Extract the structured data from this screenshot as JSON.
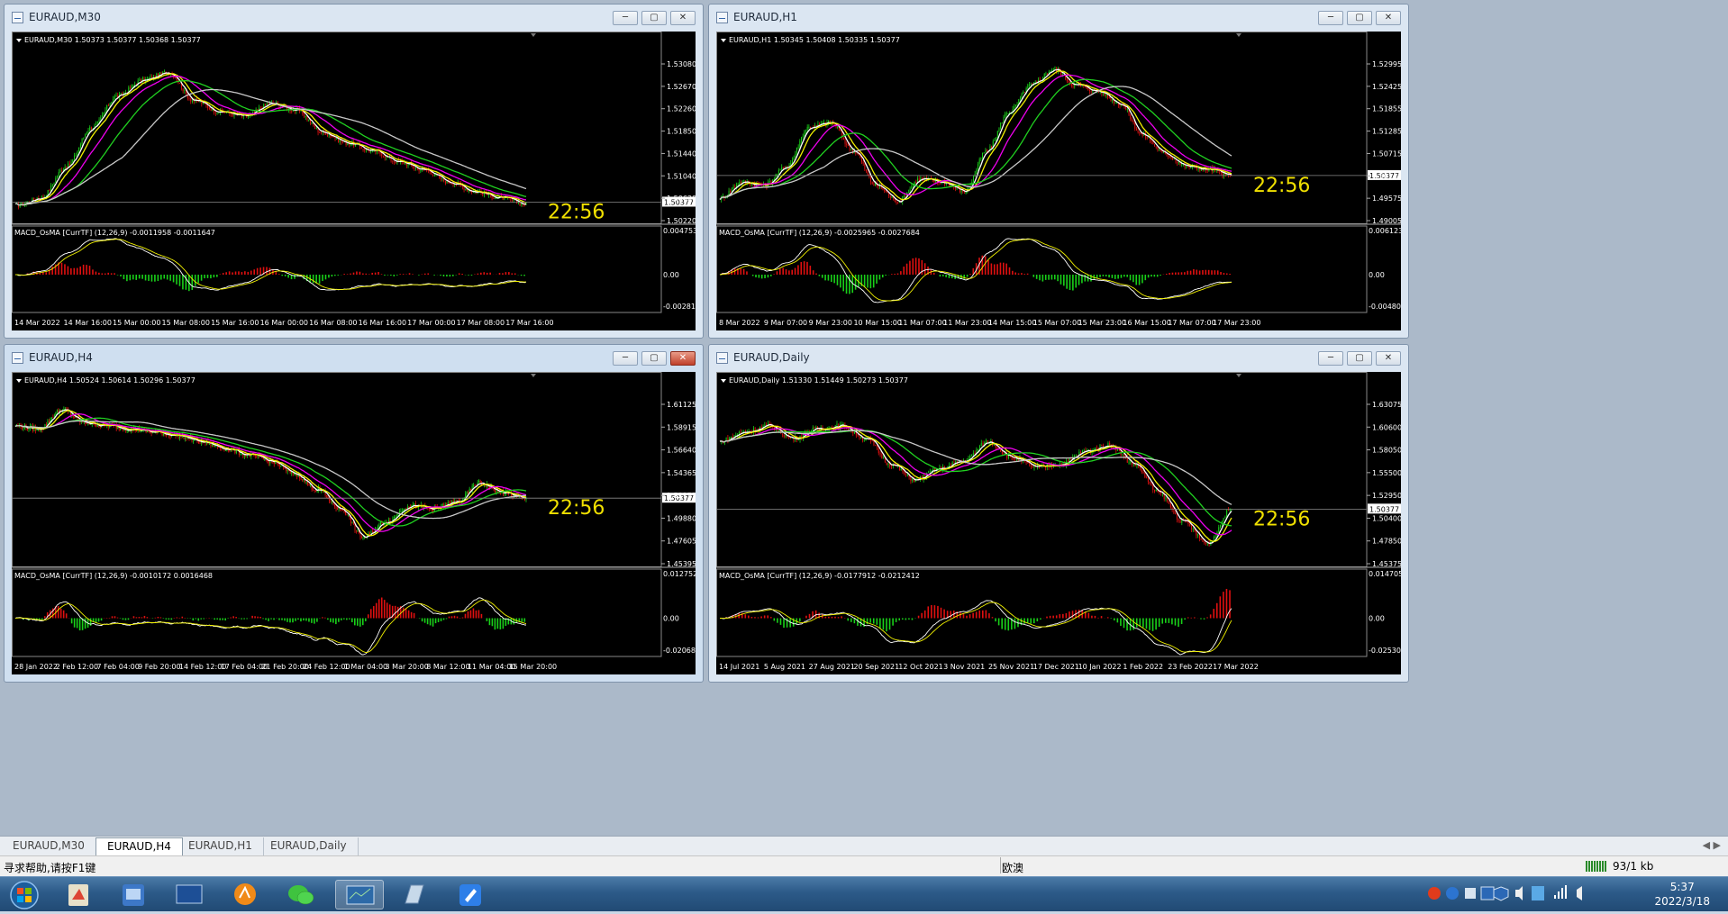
{
  "windows": [
    {
      "id": "m30",
      "title": "EURAUD,M30",
      "info": "EURAUD,M30  1.50373 1.50377 1.50368 1.50377",
      "prices": [
        "1.53080",
        "1.52670",
        "1.52260",
        "1.51850",
        "1.51440",
        "1.51040",
        "1.50630",
        "1.50220"
      ],
      "bid": "1.50377",
      "clock": "22:56",
      "macd_info": "MACD_OsMA [CurrTF] (12,26,9) -0.0011958 -0.0011647",
      "macd_scale": [
        "0.0047535",
        "0.00",
        "-0.002811"
      ],
      "dates": [
        "14 Mar 2022",
        "14 Mar 16:00",
        "15 Mar 00:00",
        "15 Mar 08:00",
        "15 Mar 16:00",
        "16 Mar 00:00",
        "16 Mar 08:00",
        "16 Mar 16:00",
        "17 Mar 00:00",
        "17 Mar 08:00",
        "17 Mar 16:00"
      ]
    },
    {
      "id": "h1",
      "title": "EURAUD,H1",
      "info": "EURAUD,H1  1.50345 1.50408 1.50335 1.50377",
      "prices": [
        "1.52995",
        "1.52425",
        "1.51855",
        "1.51285",
        "1.50715",
        "1.50145",
        "1.49575",
        "1.49005"
      ],
      "bid": "1.50377",
      "clock": "22:56",
      "macd_info": "MACD_OsMA [CurrTF] (12,26,9) -0.0025965 -0.0027684",
      "macd_scale": [
        "0.0061239",
        "0.00",
        "-0.004801"
      ],
      "dates": [
        "8 Mar 2022",
        "9 Mar 07:00",
        "9 Mar 23:00",
        "10 Mar 15:00",
        "11 Mar 07:00",
        "11 Mar 23:00",
        "14 Mar 15:00",
        "15 Mar 07:00",
        "15 Mar 23:00",
        "16 Mar 15:00",
        "17 Mar 07:00",
        "17 Mar 23:00"
      ]
    },
    {
      "id": "h4",
      "title": "EURAUD,H4",
      "info": "EURAUD,H4  1.50524 1.50614 1.50296 1.50377",
      "prices": [
        "1.61125",
        "1.58915",
        "1.56640",
        "1.54365",
        "1.52155",
        "1.49880",
        "1.47605",
        "1.45395"
      ],
      "bid": "1.50377",
      "clock": "22:56",
      "macd_info": "MACD_OsMA [CurrTF] (12,26,9) -0.0010172 0.0016468",
      "macd_scale": [
        "0.012752",
        "0.00",
        "-0.020687"
      ],
      "dates": [
        "28 Jan 2022",
        "2 Feb 12:00",
        "7 Feb 04:00",
        "9 Feb 20:00",
        "14 Feb 12:00",
        "17 Feb 04:00",
        "21 Feb 20:00",
        "24 Feb 12:00",
        "1 Mar 04:00",
        "3 Mar 20:00",
        "8 Mar 12:00",
        "11 Mar 04:00",
        "15 Mar 20:00"
      ]
    },
    {
      "id": "d1",
      "title": "EURAUD,Daily",
      "info": "EURAUD,Daily  1.51330 1.51449 1.50273 1.50377",
      "prices": [
        "1.63075",
        "1.60600",
        "1.58050",
        "1.55500",
        "1.52950",
        "1.50400",
        "1.47850",
        "1.45375"
      ],
      "bid": "1.50377",
      "clock": "22:56",
      "macd_info": "MACD_OsMA [CurrTF] (12,26,9) -0.0177912 -0.0212412",
      "macd_scale": [
        "0.0147054",
        "0.00",
        "-0.025307"
      ],
      "dates": [
        "14 Jul 2021",
        "5 Aug 2021",
        "27 Aug 2021",
        "20 Sep 2021",
        "12 Oct 2021",
        "3 Nov 2021",
        "25 Nov 2021",
        "17 Dec 2021",
        "10 Jan 2022",
        "1 Feb 2022",
        "23 Feb 2022",
        "17 Mar 2022"
      ]
    }
  ],
  "tabs": [
    "EURAUD,M30",
    "EURAUD,H4",
    "EURAUD,H1",
    "EURAUD,Daily"
  ],
  "active_tab": "EURAUD,H4",
  "status": {
    "help": "寻求帮助,请按F1键",
    "profile": "欧澳",
    "traffic": "93/1 kb"
  },
  "tray": {
    "time": "5:37",
    "date": "2022/3/18"
  },
  "colors": {
    "up_bar": "#19d019",
    "down_bar": "#e01010",
    "ma_fast": "#ffffff",
    "ma_mid": "#f0f000",
    "ma_slow": "#ee00ee",
    "ma_green": "#20d020",
    "ma_gray": "#c8c8c8",
    "clock": "#f0e000"
  }
}
